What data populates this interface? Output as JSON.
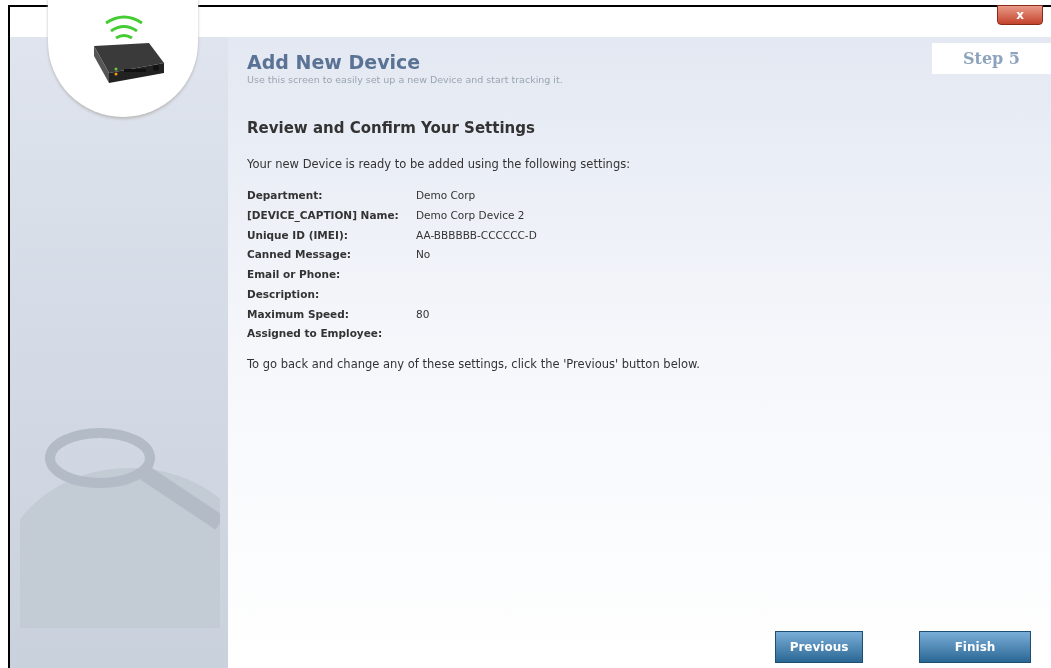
{
  "close_button": {
    "label": "x"
  },
  "step": "Step 5",
  "header": {
    "title": "Add New Device",
    "subtitle": "Use this screen to easily set up a new Device and start tracking it."
  },
  "section_title": "Review and Confirm Your Settings",
  "intro": "Your new Device is ready to be added using the following settings:",
  "settings": [
    {
      "label": "Department:",
      "value": "Demo Corp"
    },
    {
      "label": "[DEVICE_CAPTION] Name:",
      "value": "Demo Corp Device 2"
    },
    {
      "label": "Unique ID (IMEI):",
      "value": "AA-BBBBBB-CCCCCC-D"
    },
    {
      "label": "Canned Message:",
      "value": "No"
    },
    {
      "label": "Email or Phone:"
    },
    {
      "label": "Description:"
    },
    {
      "label": "Maximum Speed:",
      "value": "80"
    },
    {
      "label": "Assigned to Employee:"
    }
  ],
  "footer_note": "To go back and change any of these settings, click the 'Previous' button below.",
  "buttons": [
    {
      "label": "Previous"
    },
    {
      "label": "Finish"
    }
  ]
}
